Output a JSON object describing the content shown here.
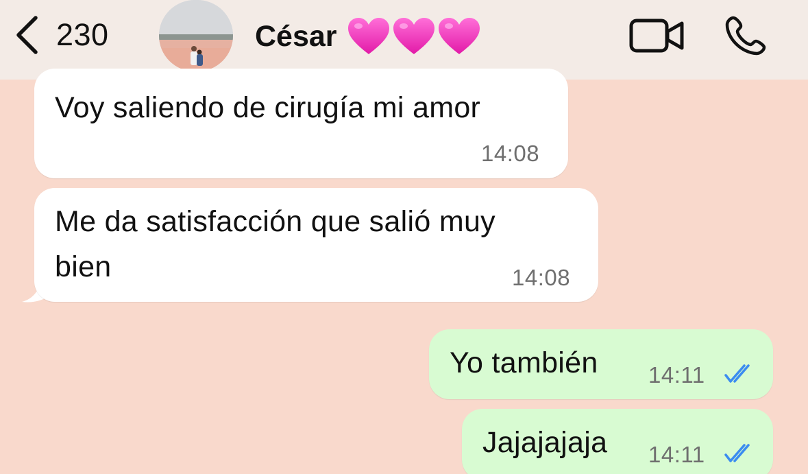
{
  "header": {
    "back_count": "230",
    "contact_name": "César",
    "hearts": [
      "pink-heart-emoji",
      "pink-heart-emoji",
      "pink-heart-emoji"
    ],
    "icons": {
      "back": "chevron-left-icon",
      "video": "video-camera-icon",
      "phone": "phone-icon"
    }
  },
  "messages": [
    {
      "direction": "incoming",
      "text": "Voy saliendo de cirugía mi amor",
      "time": "14:08"
    },
    {
      "direction": "incoming",
      "text_line1": "Me da satisfacción que salió muy",
      "text_line2": "bien",
      "time": "14:08"
    },
    {
      "direction": "outgoing",
      "text": "Yo también",
      "time": "14:11",
      "status": "read"
    },
    {
      "direction": "outgoing",
      "text": "Jajajajaja",
      "time": "14:11",
      "status": "read"
    }
  ],
  "colors": {
    "chat_background": "#f9d9cc",
    "header_background": "#f3ebe6",
    "incoming_bubble": "#ffffff",
    "outgoing_bubble": "#d8fbd2",
    "read_ticks": "#3b8cf0"
  }
}
